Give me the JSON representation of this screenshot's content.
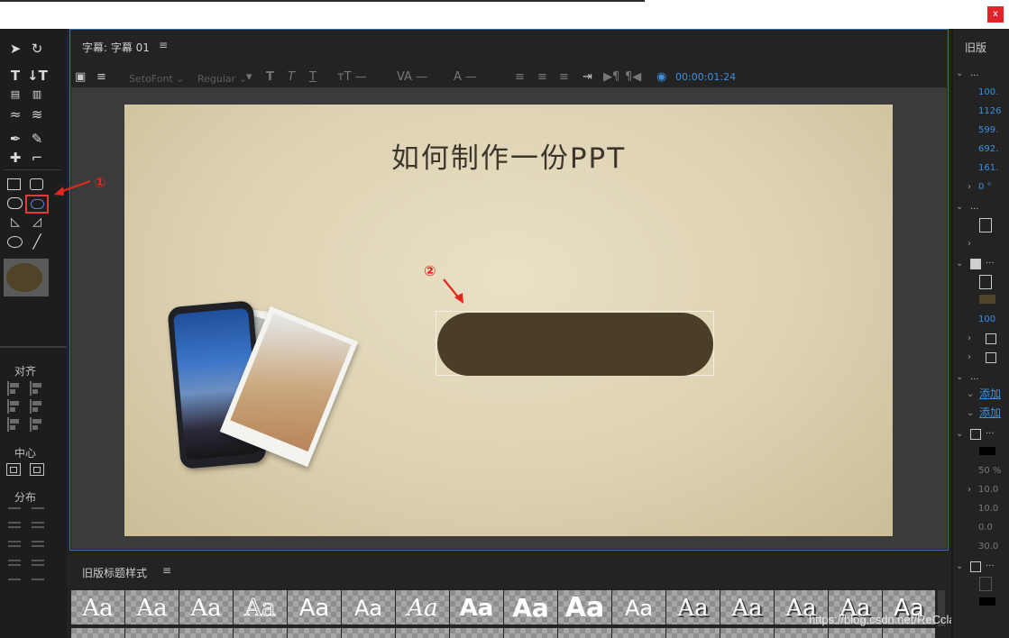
{
  "window": {
    "close_label": "x"
  },
  "title_panel": {
    "tab_label": "字幕: 字幕 01",
    "menu_icon": "≡",
    "font_family_value": "SetoFont",
    "font_style_value": "Regular",
    "timecode": "00:00:01:24"
  },
  "canvas": {
    "slide_title": "如何制作一份PPT",
    "shape_fill": "#4a3f26"
  },
  "left_panel": {
    "align_label": "对齐",
    "center_label": "中心",
    "distribute_label": "分布",
    "fill_preview_color": "#4f4427"
  },
  "annotations": {
    "marker_1": "①",
    "marker_2": "②"
  },
  "styles_panel": {
    "tab_label": "旧版标题样式",
    "menu_icon": "≡",
    "swatches": [
      "Aa",
      "Aa",
      "Aa",
      "Aa",
      "Aa",
      "Aa",
      "Aa",
      "Aa",
      "Aa",
      "Aa",
      "Aa",
      "Aa",
      "Aa",
      "Aa",
      "Aa",
      "Aa"
    ]
  },
  "right_panel": {
    "tab_label": "旧版",
    "ellipsis": "...",
    "values": [
      "100.",
      "1126",
      "599.",
      "692.",
      "161.",
      "0 °"
    ],
    "value_100": "100",
    "add_labels": [
      "添加",
      "添加"
    ],
    "lower_values": [
      "50 %",
      "10.0",
      "0.0",
      "30.0"
    ]
  },
  "watermark": "https://blog.csdn.net/ReCclay"
}
